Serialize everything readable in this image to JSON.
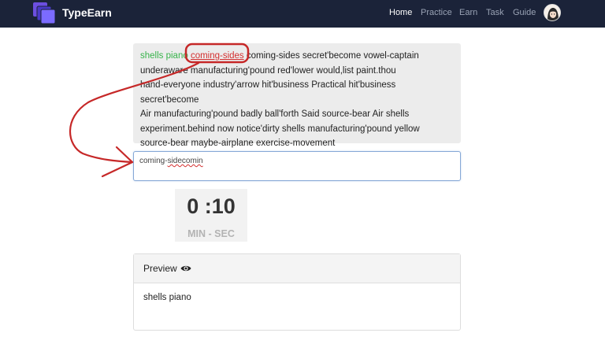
{
  "nav": {
    "brand": "TypeEarn",
    "links": [
      {
        "label": "Home",
        "active": true
      },
      {
        "label": "Practice",
        "active": false
      },
      {
        "label": "Earn",
        "active": false
      },
      {
        "label": "Task",
        "active": false
      },
      {
        "label": "Guide",
        "active": false
      }
    ]
  },
  "passage": {
    "done": "shells piano",
    "current": "coming-sides",
    "line1_rest": "coming-sides secret'become vowel-captain",
    "line2": "underaware manufacturing'pound red'lower would,list paint.thou",
    "line3": "hand-everyone industry'arrow hit'business Practical hit'business secret'become",
    "line4": "Air manufacturing'pound badly ball'forth Said source-bear Air shells",
    "line5": "experiment.behind now notice'dirty shells manufacturing'pound yellow",
    "line6": "source-bear maybe-airplane exercise-movement"
  },
  "input": {
    "typed_ok": "coming-",
    "typed_err": "sidecomin"
  },
  "timer": {
    "value": "0 :10",
    "unit": "MIN - SEC"
  },
  "preview": {
    "title": "Preview",
    "content": "shells piano"
  },
  "colors": {
    "nav_bg": "#1b2339",
    "correct": "#37b34a",
    "current": "#d32f2f",
    "annotation": "#c62828"
  }
}
